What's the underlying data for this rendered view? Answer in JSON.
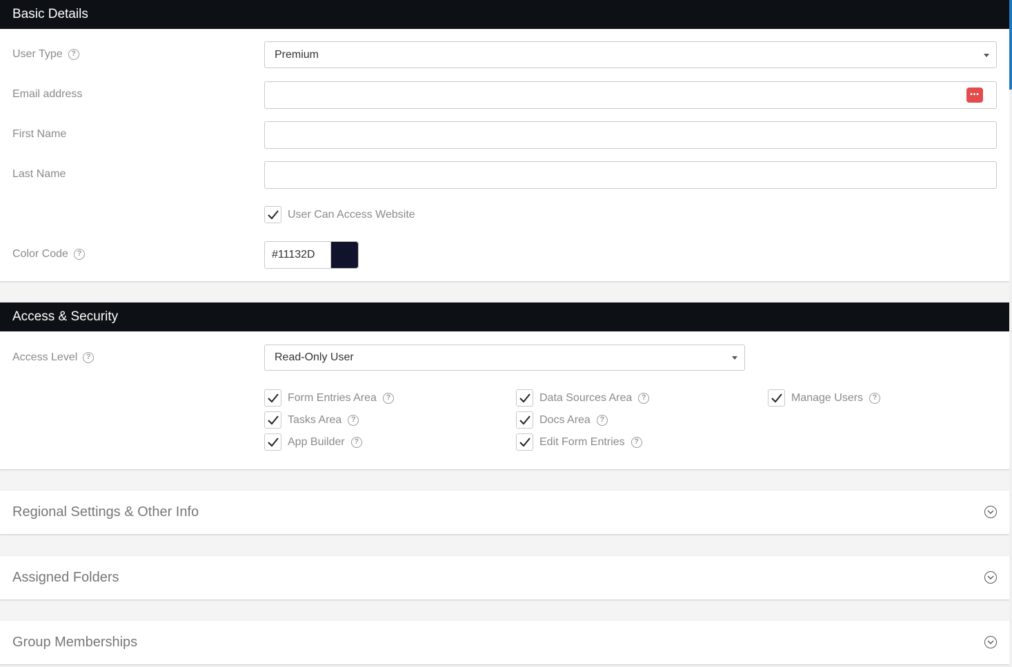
{
  "basic": {
    "title": "Basic Details",
    "user_type_label": "User Type",
    "user_type_value": "Premium",
    "email_label": "Email address",
    "email_value": "",
    "password_manager_icon": "password-manager-icon",
    "first_name_label": "First Name",
    "first_name_value": "",
    "last_name_label": "Last Name",
    "last_name_value": "",
    "website_access_label": "User Can Access Website",
    "website_access_checked": true,
    "color_label": "Color Code",
    "color_value": "#11132D",
    "color_swatch": "#11132D"
  },
  "access": {
    "title": "Access & Security",
    "level_label": "Access Level",
    "level_value": "Read-Only User",
    "permissions": [
      {
        "label": "Form Entries Area",
        "checked": true
      },
      {
        "label": "Data Sources Area",
        "checked": true
      },
      {
        "label": "Manage Users",
        "checked": true
      },
      {
        "label": "Tasks Area",
        "checked": true
      },
      {
        "label": "Docs Area",
        "checked": true
      },
      {
        "label": "App Builder",
        "checked": true
      },
      {
        "label": "Edit Form Entries",
        "checked": true
      }
    ]
  },
  "sections": {
    "regional": "Regional Settings & Other Info",
    "folders": "Assigned Folders",
    "groups": "Group Memberships"
  },
  "colors": {
    "header_bg": "#0d1116",
    "scroll_accent": "#1f7ac4",
    "password_icon": "#e34c4c"
  }
}
